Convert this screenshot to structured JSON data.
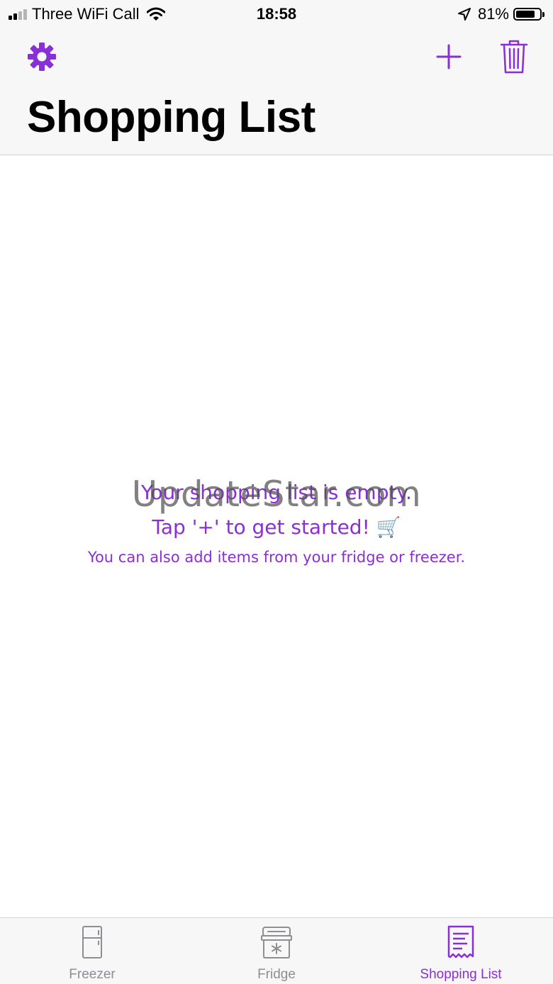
{
  "status_bar": {
    "carrier": "Three WiFi Call",
    "time": "18:58",
    "battery_percent": "81%",
    "battery_level": 0.81,
    "signal_bars_active": 2,
    "icons": [
      "signal-icon",
      "wifi-icon",
      "location-arrow-icon",
      "battery-icon"
    ]
  },
  "header": {
    "title": "Shopping List",
    "icons": {
      "settings": "gear-icon",
      "add": "plus-icon",
      "delete": "trash-icon"
    }
  },
  "empty_state": {
    "line1": "Your shopping list is empty.",
    "line2": "Tap '+' to get started!",
    "line2_emoji": "🛒",
    "line3": "You can also add items from your fridge or freezer."
  },
  "watermark": "UpdateStar.com",
  "tabs": [
    {
      "label": "Freezer",
      "icon": "freezer-icon",
      "active": false
    },
    {
      "label": "Fridge",
      "icon": "fridge-icon",
      "active": false
    },
    {
      "label": "Shopping List",
      "icon": "receipt-icon",
      "active": true
    }
  ],
  "colors": {
    "accent": "#8a2fd6",
    "inactive": "#8e8e93",
    "bar_background": "#f7f7f7",
    "text": "#000000"
  }
}
